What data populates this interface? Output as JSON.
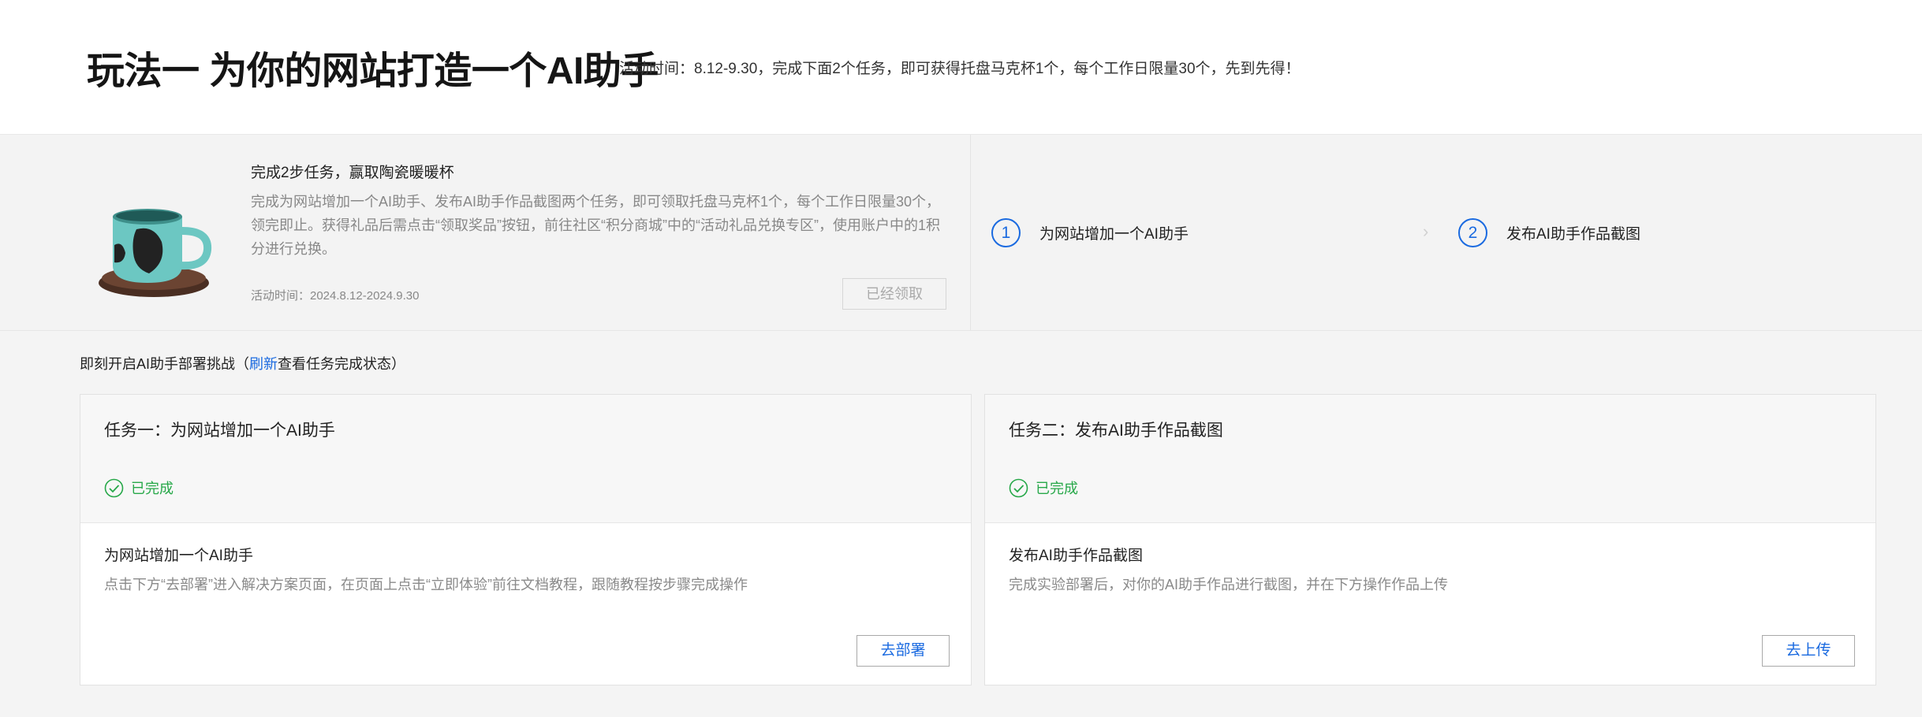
{
  "header": {
    "title": "玩法一 为你的网站打造一个AI助手",
    "activity_info": "活动时间：8.12-9.30，完成下面2个任务，即可获得托盘马克杯1个，每个工作日限量30个，先到先得！"
  },
  "promo": {
    "image_icon": "mug-with-saucer",
    "title": "完成2步任务，赢取陶瓷暖暖杯",
    "description": "完成为网站增加一个AI助手、发布AI助手作品截图两个任务，即可领取托盘马克杯1个，每个工作日限量30个，领完即止。获得礼品后需点击“领取奖品”按钮，前往社区“积分商城”中的“活动礼品兑换专区”，使用账户中的1积分进行兑换。",
    "time": "活动时间：2024.8.12-2024.9.30",
    "claimed_label": "已经领取",
    "steps": [
      {
        "num": "1",
        "label": "为网站增加一个AI助手"
      },
      {
        "num": "2",
        "label": "发布AI助手作品截图"
      }
    ],
    "separator_icon": "chevron-right-icon"
  },
  "challenge": {
    "prefix": "即刻开启AI助手部署挑战（",
    "refresh_label": "刷新",
    "suffix": "查看任务完成状态）"
  },
  "tasks": [
    {
      "title": "任务一：为网站增加一个AI助手",
      "status": "已完成",
      "subtitle": "为网站增加一个AI助手",
      "description": "点击下方“去部署”进入解决方案页面，在页面上点击“立即体验”前往文档教程，跟随教程按步骤完成操作",
      "button_label": "去部署"
    },
    {
      "title": "任务二：发布AI助手作品截图",
      "status": "已完成",
      "subtitle": "发布AI助手作品截图",
      "description": "完成实验部署后，对你的AI助手作品进行截图，并在下方操作作品上传",
      "button_label": "去上传"
    }
  ],
  "colors": {
    "accent_blue": "#1a6ae0",
    "success_green": "#27a849"
  }
}
